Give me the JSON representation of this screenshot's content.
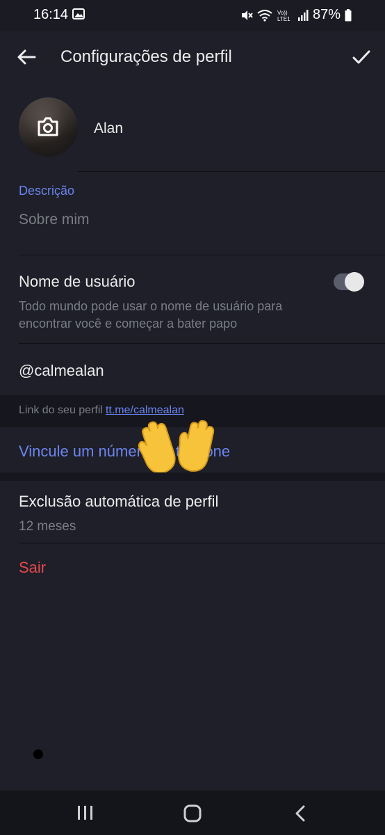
{
  "status_bar": {
    "time": "16:14",
    "battery": "87%",
    "icons": [
      "gallery-icon",
      "mute-icon",
      "wifi-icon",
      "volte-icon",
      "signal-icon",
      "battery-icon"
    ]
  },
  "header": {
    "title": "Configurações de perfil",
    "back_icon": "back-arrow-icon",
    "confirm_icon": "check-icon"
  },
  "profile": {
    "name": "Alan",
    "avatar_icon": "camera-icon"
  },
  "description": {
    "label": "Descrição",
    "placeholder": "Sobre mim"
  },
  "username_setting": {
    "label": "Nome de usuário",
    "help": "Todo mundo pode usar o nome de usuário para encontrar você e começar a bater papo",
    "enabled": true,
    "handle": "@calmealan"
  },
  "profile_link": {
    "prefix": "Link do seu perfil",
    "url": "tt.me/calmealan"
  },
  "link_phone": {
    "label": "Vincule um número de telefone",
    "overlay_emoji": "waving-hands"
  },
  "auto_delete": {
    "label": "Exclusão automática de perfil",
    "value": "12 meses"
  },
  "logout": {
    "label": "Sair"
  },
  "colors": {
    "background": "#1e1f28",
    "accent": "#6c85f0",
    "danger": "#e5484d",
    "secondary_text": "#7b7d86"
  },
  "nav_bar": {
    "icons": [
      "recent-apps-icon",
      "home-icon",
      "back-icon"
    ]
  }
}
